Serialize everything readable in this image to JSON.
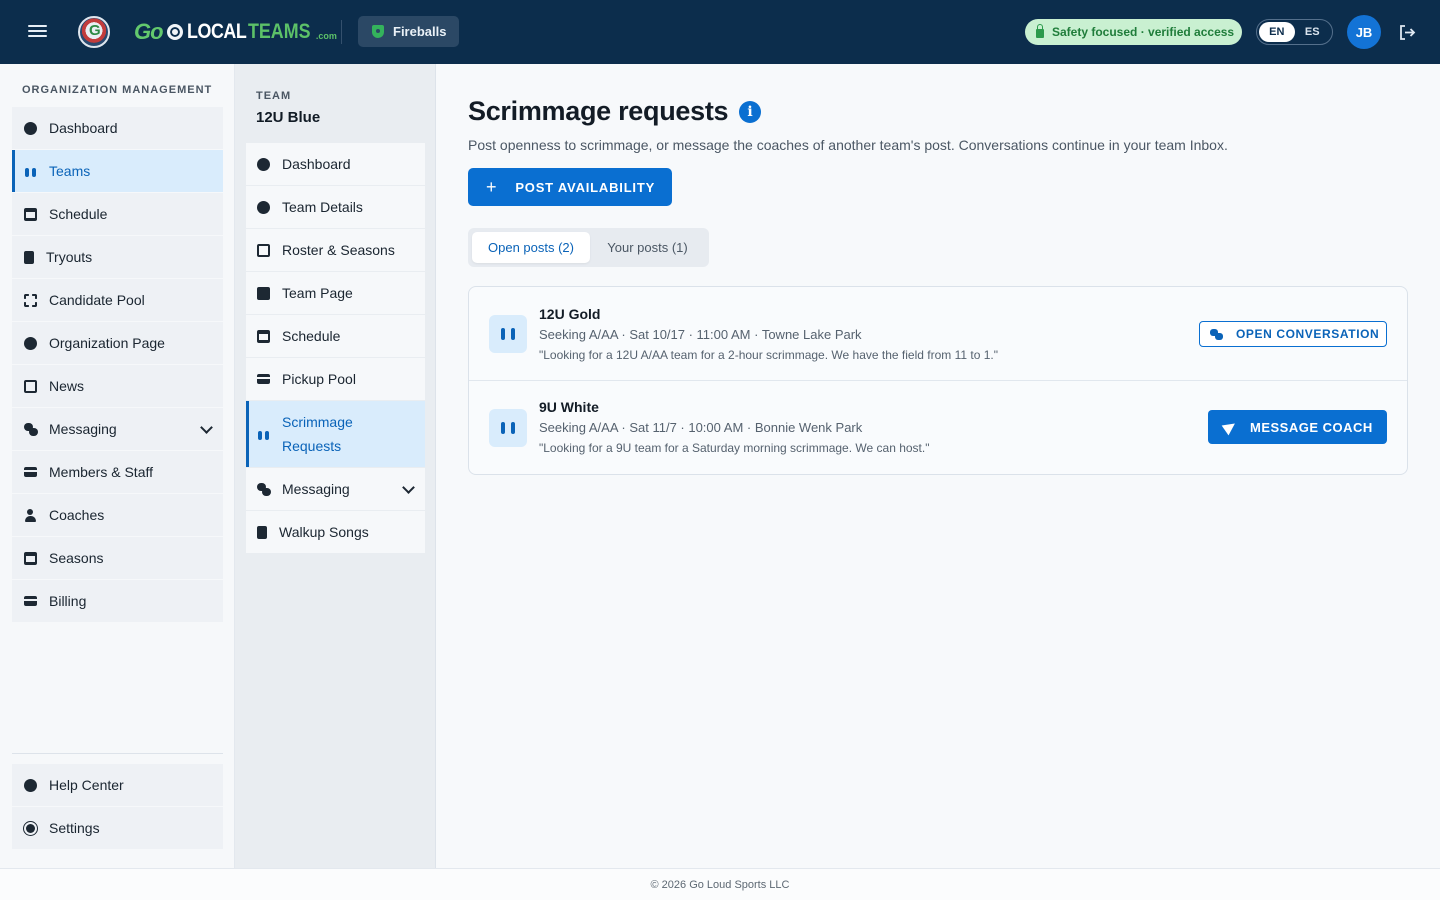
{
  "topbar": {
    "logo_go": "Go",
    "logo_local": "LOCAL",
    "logo_teams": "TEAMS",
    "logo_com": ".com",
    "team_switcher": "Fireballs",
    "safety_badge": "Safety focused · verified access",
    "languages": [
      "EN",
      "ES"
    ],
    "active_language": "EN",
    "avatar_initials": "JB"
  },
  "sidebar": {
    "heading": "ORGANIZATION MANAGEMENT",
    "items": [
      {
        "label": "Dashboard",
        "icon": "dashboard-icon"
      },
      {
        "label": "Teams",
        "icon": "teams-icon"
      },
      {
        "label": "Schedule",
        "icon": "calendar-icon"
      },
      {
        "label": "Tryouts",
        "icon": "clipboard-icon"
      },
      {
        "label": "Candidate Pool",
        "icon": "candidate-pool-icon"
      },
      {
        "label": "Organization Page",
        "icon": "globe-icon"
      },
      {
        "label": "News",
        "icon": "news-icon"
      },
      {
        "label": "Messaging",
        "icon": "messaging-icon"
      },
      {
        "label": "Members & Staff",
        "icon": "id-card-icon"
      },
      {
        "label": "Coaches",
        "icon": "coach-icon"
      },
      {
        "label": "Seasons",
        "icon": "calendar-icon"
      },
      {
        "label": "Billing",
        "icon": "credit-card-icon"
      }
    ],
    "bottom_items": [
      {
        "label": "Help Center",
        "icon": "help-icon"
      },
      {
        "label": "Settings",
        "icon": "gear-icon"
      }
    ],
    "active": "Teams"
  },
  "team_nav": {
    "label": "TEAM",
    "team_name": "12U Blue",
    "items": [
      {
        "label": "Dashboard",
        "icon": "dashboard-icon"
      },
      {
        "label": "Team Details",
        "icon": "info-icon"
      },
      {
        "label": "Roster & Seasons",
        "icon": "list-icon"
      },
      {
        "label": "Team Page",
        "icon": "edit-page-icon"
      },
      {
        "label": "Schedule",
        "icon": "calendar-icon"
      },
      {
        "label": "Pickup Pool",
        "icon": "pool-icon"
      },
      {
        "label": "Scrimmage Requests",
        "icon": "scrimmage-icon"
      },
      {
        "label": "Messaging",
        "icon": "messaging-icon"
      },
      {
        "label": "Walkup Songs",
        "icon": "music-icon"
      }
    ],
    "active": "Scrimmage Requests"
  },
  "main": {
    "title": "Scrimmage requests",
    "description": "Post openness to scrimmage, or message the coaches of another team's post. Conversations continue in your team Inbox.",
    "post_button": "POST AVAILABILITY",
    "tabs": [
      {
        "label": "Open posts (2)",
        "active": true
      },
      {
        "label": "Your posts (1)",
        "active": false
      }
    ],
    "posts": [
      {
        "team": "12U Gold",
        "meta": "Seeking A/AA · Sat 10/17 · 11:00 AM · Towne Lake Park",
        "quote": "\"Looking for a 12U A/AA team for a 2-hour scrimmage. We have the field from 11 to 1.\"",
        "action": "OPEN CONVERSATION"
      },
      {
        "team": "9U White",
        "meta": "Seeking A/AA · Sat 11/7 · 10:00 AM · Bonnie Wenk Park",
        "quote": "\"Looking for a 9U team for a Saturday morning scrimmage. We can host.\"",
        "action": "MESSAGE COACH"
      }
    ]
  },
  "footer": {
    "copyright": "© 2026 Go Loud Sports LLC"
  },
  "colors": {
    "header_bg": "#0c2d4c",
    "accent": "#0a6fd1",
    "active_bg": "#d9ecfc",
    "safety_bg": "#c9f0d1",
    "safety_text": "#1f7d3a"
  }
}
